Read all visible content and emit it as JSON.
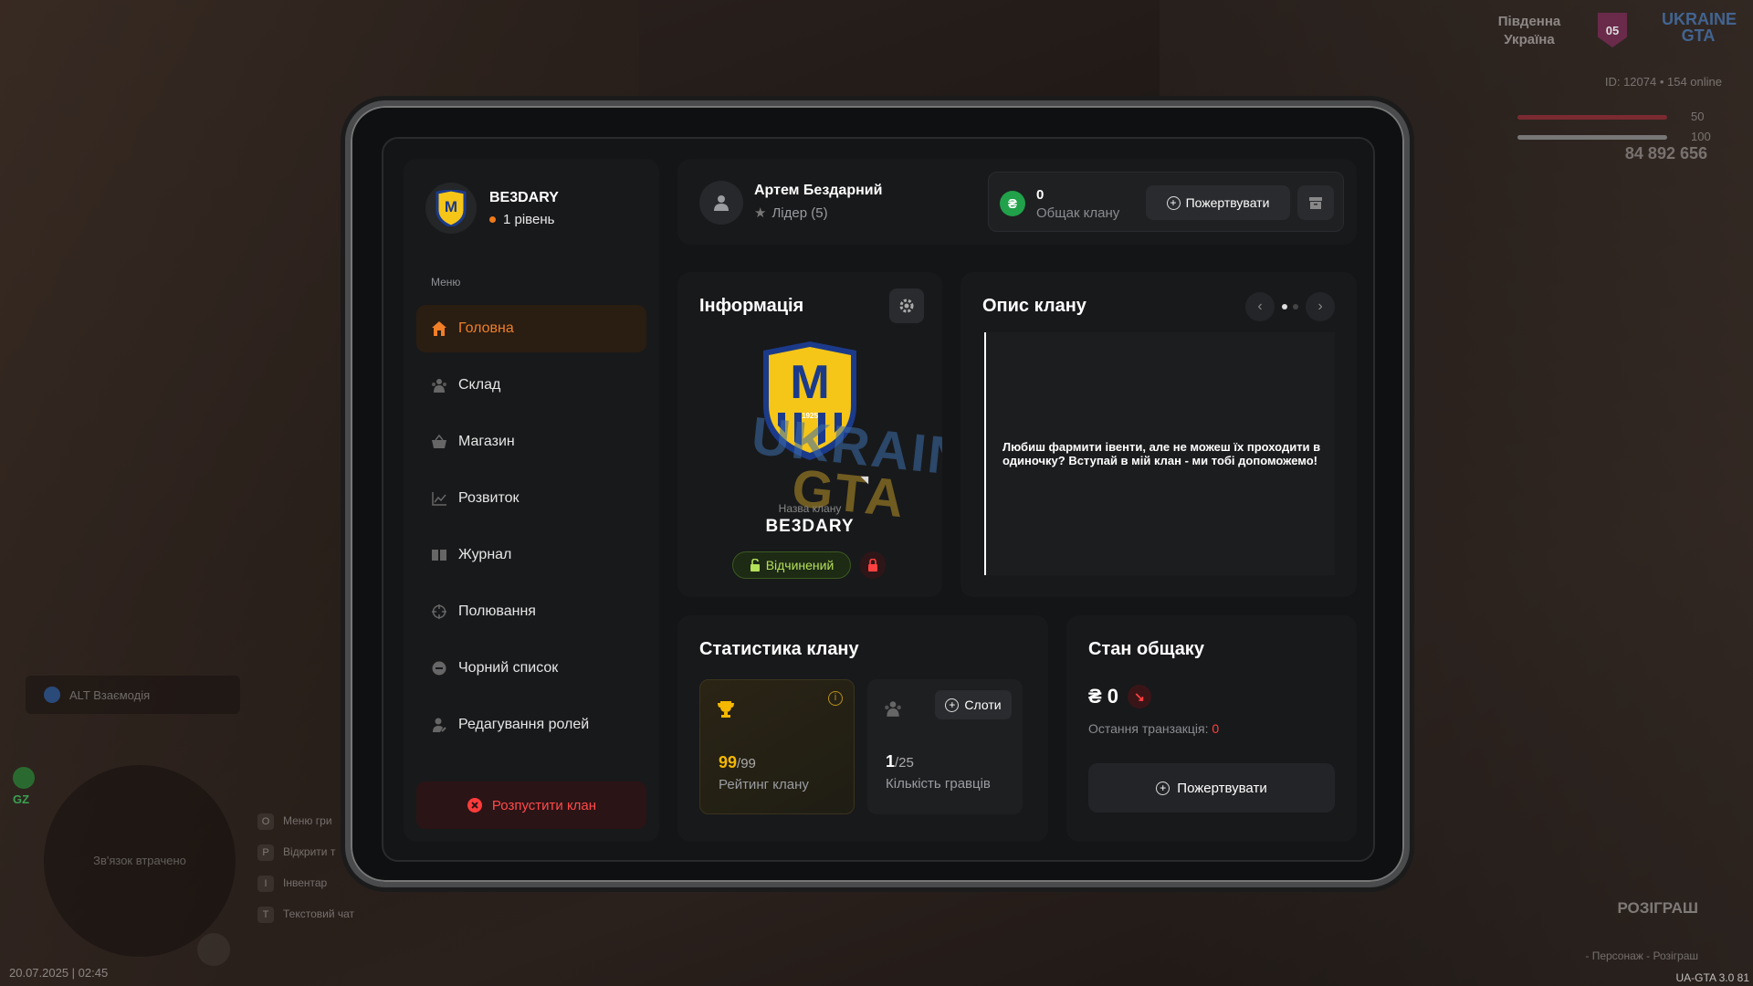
{
  "hud": {
    "region": "Південна Україна",
    "region_badge": "05",
    "logo": "UKRAINE GTA",
    "id_line": "ID: 12074 • 154 online",
    "health": "50",
    "armor": "100",
    "money": "84 892 656",
    "interact": "ALT Взаємодія",
    "map_text": "Зв'язок втрачено",
    "gz": "GZ",
    "keys": [
      {
        "key": "O",
        "label": "Меню гри"
      },
      {
        "key": "P",
        "label": "Відкрити т"
      },
      {
        "key": "I",
        "label": "Інвентар"
      },
      {
        "key": "T",
        "label": "Текстовий чат"
      }
    ],
    "datetime": "20.07.2025 | 02:45",
    "giveaway_title": "РОЗІГРАШ",
    "giveaway_sub": "- Персонаж - Розіграш",
    "version": "UA-GTA 3.0 81"
  },
  "sidebar": {
    "clan_name": "BE3DARY",
    "clan_level": "1 рівень",
    "menu_label": "Меню",
    "items": [
      {
        "label": "Головна",
        "icon": "home-icon",
        "active": true
      },
      {
        "label": "Склад",
        "icon": "people-icon"
      },
      {
        "label": "Магазин",
        "icon": "basket-icon"
      },
      {
        "label": "Розвиток",
        "icon": "chart-icon"
      },
      {
        "label": "Журнал",
        "icon": "book-icon"
      },
      {
        "label": "Полювання",
        "icon": "crosshair-icon"
      },
      {
        "label": "Чорний список",
        "icon": "block-icon"
      },
      {
        "label": "Редагування ролей",
        "icon": "user-edit-icon"
      }
    ],
    "disband_label": "Розпустити клан"
  },
  "user": {
    "name": "Артем Бездарний",
    "role": "Лідер (5)",
    "bank_value": "0",
    "bank_label": "Общак клану",
    "donate_label": "Пожертвувати"
  },
  "info": {
    "title": "Інформація",
    "clan_name_label": "Назва клану",
    "clan_name": "BE3DARY",
    "status_label": "Відчинений",
    "watermark_1": "UKRAINE",
    "watermark_2": "GTA"
  },
  "description": {
    "title": "Опис клану",
    "text": "Любиш фармити івенти, але не можеш їх проходити в одиночку? Вступай в мій клан - ми тобі допоможемо!",
    "page_count": 2,
    "current_page": 1
  },
  "stats": {
    "title": "Статистика клану",
    "rating_value": "99",
    "rating_max": "/99",
    "rating_label": "Рейтинг клану",
    "players_value": "1",
    "players_max": "/25",
    "players_label": "Кількість гравців",
    "slots_label": "Слоти"
  },
  "bank": {
    "title": "Стан общаку",
    "amount": "₴ 0",
    "last_tx_label": "Остання транзакція:",
    "last_tx_value": "0",
    "donate_label": "Пожертвувати"
  },
  "colors": {
    "accent": "#f07f28",
    "danger": "#ff4040",
    "success": "#21a14a",
    "open": "#b4e05a"
  }
}
